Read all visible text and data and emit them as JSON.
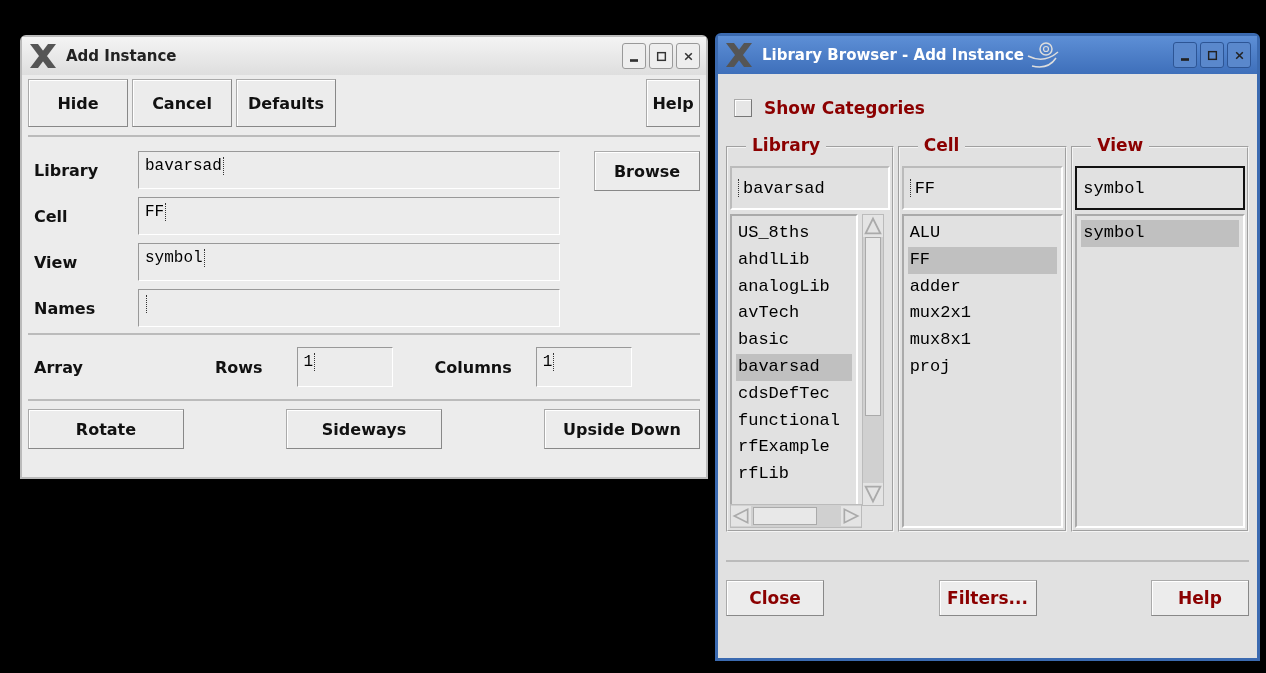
{
  "add_instance": {
    "title": "Add Instance",
    "active": false,
    "top_buttons": [
      "Hide",
      "Cancel",
      "Defaults",
      "Help"
    ],
    "fields": [
      {
        "label": "Library",
        "value": "bavarsad"
      },
      {
        "label": "Cell",
        "value": "FF"
      },
      {
        "label": "View",
        "value": "symbol"
      },
      {
        "label": "Names"
      }
    ],
    "browse_button": "Browse",
    "array": {
      "label": "Array",
      "rows_label": "Rows",
      "rows_value": "1",
      "columns_label": "Columns",
      "columns_value": "1"
    },
    "bottom_buttons": [
      "Rotate",
      "Sideways",
      "Upside Down"
    ]
  },
  "library_browser": {
    "title": "Library Browser - Add Instance",
    "active": true,
    "show_categories": {
      "label": "Show Categories",
      "checked": false
    },
    "columns": [
      {
        "heading": "Library",
        "filter": "bavarsad",
        "focused": false,
        "items": [
          {
            "label": "US_8ths",
            "selected": false
          },
          {
            "label": "ahdlLib",
            "selected": false
          },
          {
            "label": "analogLib",
            "selected": false
          },
          {
            "label": "avTech",
            "selected": false
          },
          {
            "label": "basic",
            "selected": false
          },
          {
            "label": "bavarsad",
            "selected": true
          },
          {
            "label": "cdsDefTec",
            "selected": false
          },
          {
            "label": "functional",
            "selected": false
          },
          {
            "label": "rfExample",
            "selected": false
          },
          {
            "label": "rfLib",
            "selected": false
          }
        ]
      },
      {
        "heading": "Cell",
        "filter": "FF",
        "focused": false,
        "items": [
          {
            "label": "ALU",
            "selected": false
          },
          {
            "label": "FF",
            "selected": true
          },
          {
            "label": "adder",
            "selected": false
          },
          {
            "label": "mux2x1",
            "selected": false
          },
          {
            "label": "mux8x1",
            "selected": false
          },
          {
            "label": "proj",
            "selected": false
          }
        ]
      },
      {
        "heading": "View",
        "filter": "symbol",
        "focused": true,
        "items": [
          {
            "label": "symbol",
            "selected": true
          }
        ]
      }
    ],
    "buttons": [
      "Close",
      "Filters...",
      "Help"
    ]
  }
}
